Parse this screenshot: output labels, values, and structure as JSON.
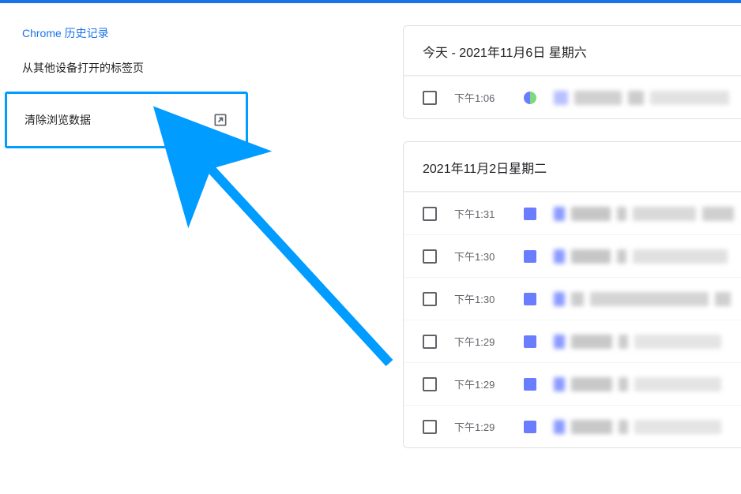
{
  "colors": {
    "accent": "#009cff",
    "link": "#1a73e8",
    "text": "#202124",
    "muted": "#5f6368"
  },
  "sidebar": {
    "items": [
      {
        "label": "Chrome 历史记录",
        "active": true
      },
      {
        "label": "从其他设备打开的标签页",
        "active": false
      }
    ],
    "clear_label": "清除浏览数据"
  },
  "sections": [
    {
      "header": "今天 - 2021年11月6日 星期六",
      "rows": [
        {
          "time": "下午1:06",
          "favicon": "round"
        }
      ]
    },
    {
      "header": "2021年11月2日星期二",
      "rows": [
        {
          "time": "下午1:31",
          "favicon": "square"
        },
        {
          "time": "下午1:30",
          "favicon": "square"
        },
        {
          "time": "下午1:30",
          "favicon": "square"
        },
        {
          "time": "下午1:29",
          "favicon": "square"
        },
        {
          "time": "下午1:29",
          "favicon": "square"
        },
        {
          "time": "下午1:29",
          "favicon": "square"
        }
      ]
    }
  ]
}
